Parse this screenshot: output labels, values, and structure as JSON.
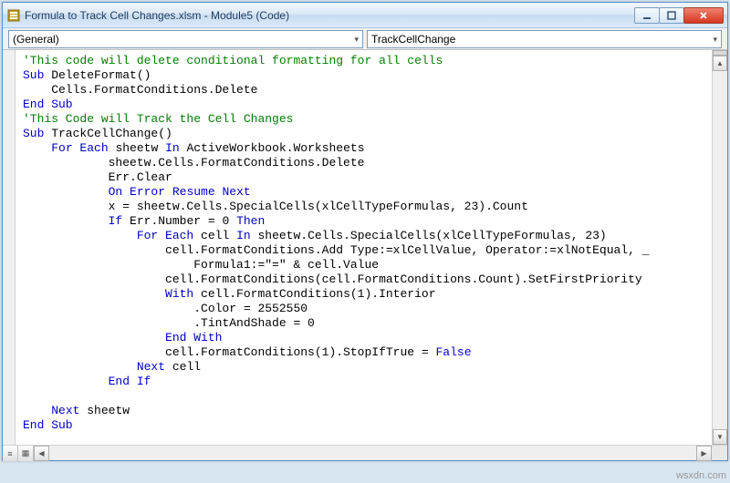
{
  "window": {
    "title": "Formula to Track Cell Changes.xlsm - Module5 (Code)"
  },
  "toolbar": {
    "object_combo": "(General)",
    "proc_combo": "TrackCellChange"
  },
  "code": {
    "l1": "'This code will delete conditional formatting for all cells",
    "l2a": "Sub",
    "l2b": " DeleteFormat()",
    "l3": "    Cells.FormatConditions.Delete",
    "l4": "End Sub",
    "l5": "'This Code will Track the Cell Changes",
    "l6a": "Sub",
    "l6b": " TrackCellChange()",
    "l7a": "    ",
    "l7b": "For Each",
    "l7c": " sheetw ",
    "l7d": "In",
    "l7e": " ActiveWorkbook.Worksheets",
    "l8": "            sheetw.Cells.FormatConditions.Delete",
    "l9": "            Err.Clear",
    "l10a": "            ",
    "l10b": "On Error Resume Next",
    "l11": "            x = sheetw.Cells.SpecialCells(xlCellTypeFormulas, 23).Count",
    "l12a": "            ",
    "l12b": "If",
    "l12c": " Err.Number = 0 ",
    "l12d": "Then",
    "l13a": "                ",
    "l13b": "For Each",
    "l13c": " cell ",
    "l13d": "In",
    "l13e": " sheetw.Cells.SpecialCells(xlCellTypeFormulas, 23)",
    "l14": "                    cell.FormatConditions.Add Type:=xlCellValue, Operator:=xlNotEqual, _",
    "l15": "                        Formula1:=\"=\" & cell.Value",
    "l16": "                    cell.FormatConditions(cell.FormatConditions.Count).SetFirstPriority",
    "l17a": "                    ",
    "l17b": "With",
    "l17c": " cell.FormatConditions(1).Interior",
    "l18": "                        .Color = 2552550",
    "l19": "                        .TintAndShade = 0",
    "l20a": "                    ",
    "l20b": "End With",
    "l21a": "                    cell.FormatConditions(1).StopIfTrue = ",
    "l21b": "False",
    "l22a": "                ",
    "l22b": "Next",
    "l22c": " cell",
    "l23a": "            ",
    "l23b": "End If",
    "l24": "",
    "l25a": "    ",
    "l25b": "Next",
    "l25c": " sheetw",
    "l26": "End Sub"
  },
  "watermark": "wsxdn.com"
}
